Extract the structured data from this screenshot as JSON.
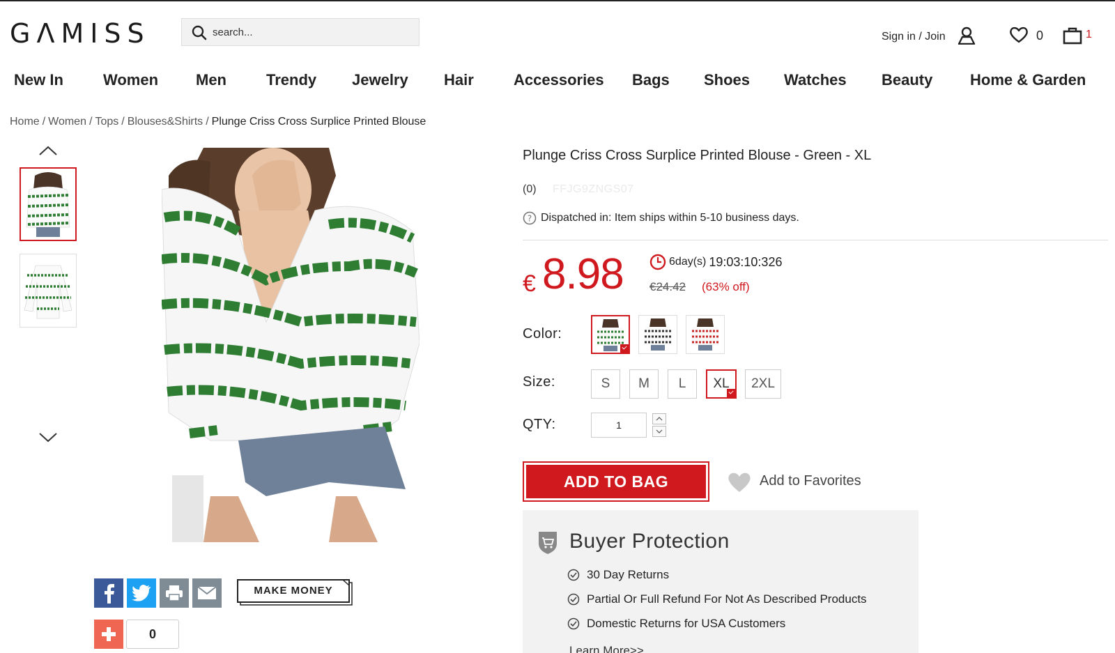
{
  "header": {
    "logo": "GΛMISS",
    "search_placeholder": "search...",
    "signin_label": "Sign in / Join",
    "wishlist_count": "0",
    "bag_count": "1"
  },
  "nav": {
    "items": [
      "New In",
      "Women",
      "Men",
      "Trendy",
      "Jewelry",
      "Hair",
      "Accessories",
      "Bags",
      "Shoes",
      "Watches",
      "Beauty",
      "Home & Garden"
    ]
  },
  "breadcrumb": {
    "items": [
      "Home",
      "Women",
      "Tops",
      "Blouses&Shirts"
    ],
    "current": "Plunge Criss Cross Surplice Printed Blouse"
  },
  "product": {
    "title": "Plunge Criss Cross Surplice Printed Blouse - Green - XL",
    "reviews": "(0)",
    "sku": "FFJG9ZNGS07",
    "dispatch": "Dispatched in: Item ships within 5-10 business days.",
    "currency": "€",
    "price": "8.98",
    "countdown_days": "6day(s)",
    "countdown_time": "19:03:10:326",
    "old_price": "€24.42",
    "discount": "(63% off)",
    "color_label": "Color:",
    "size_label": "Size:",
    "qty_label": "QTY:",
    "sizes": [
      "S",
      "M",
      "L",
      "XL",
      "2XL"
    ],
    "selected_size": "XL",
    "qty": "1",
    "add_to_bag": "ADD TO BAG",
    "add_to_favorites": "Add to Favorites"
  },
  "protection": {
    "title": "Buyer Protection",
    "items": [
      "30 Day Returns",
      "Partial Or Full Refund For Not As Described Products",
      "Domestic Returns for USA Customers"
    ],
    "learn_more": "Learn More>>"
  },
  "share": {
    "make_money": "MAKE MONEY",
    "share_count": "0"
  },
  "colors": {
    "accent": "#d0191f",
    "stripe_green": "#2e7d32",
    "stripe_red": "#c62828"
  }
}
